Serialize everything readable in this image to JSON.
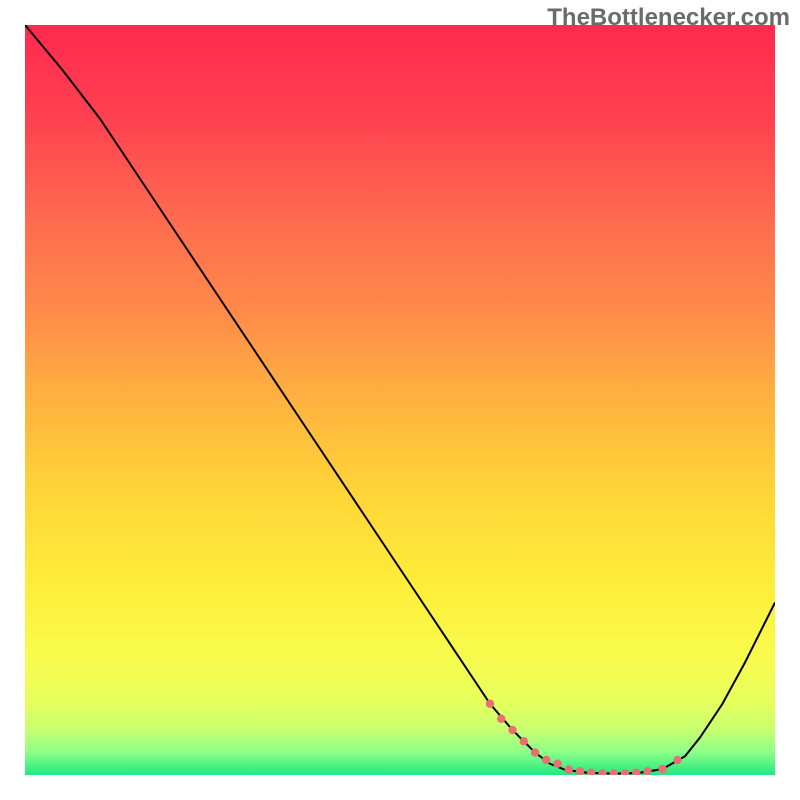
{
  "watermark": "TheBottlenecker.com",
  "chart_data": {
    "type": "line",
    "title": "",
    "xlabel": "",
    "ylabel": "",
    "xlim": [
      0,
      100
    ],
    "ylim": [
      0,
      100
    ],
    "series": [
      {
        "name": "curve",
        "x": [
          0,
          5,
          10,
          15,
          20,
          25,
          30,
          35,
          40,
          45,
          50,
          55,
          60,
          62,
          65,
          68,
          70,
          72,
          75,
          78,
          80,
          82,
          85,
          88,
          90,
          93,
          96,
          100
        ],
        "y": [
          100,
          94,
          87.5,
          80,
          72.5,
          65,
          57.5,
          50,
          42.5,
          35,
          27.5,
          20,
          12.5,
          9.5,
          6,
          3,
          1.5,
          0.7,
          0.3,
          0.2,
          0.2,
          0.3,
          0.8,
          2.5,
          5,
          9.5,
          15,
          23
        ]
      },
      {
        "name": "highlight",
        "x": [
          62,
          63.5,
          65,
          66.5,
          68,
          69.5,
          71,
          72.5,
          74,
          75.5,
          77,
          78.5,
          80,
          81.5,
          83,
          85,
          87
        ],
        "y": [
          9.5,
          7.5,
          6,
          4.5,
          3,
          2,
          1.5,
          0.7,
          0.5,
          0.3,
          0.2,
          0.2,
          0.2,
          0.3,
          0.5,
          0.8,
          2.0
        ]
      }
    ],
    "gradient_stops": [
      {
        "offset": 0.0,
        "color": "#ff2a4e"
      },
      {
        "offset": 0.12,
        "color": "#ff4050"
      },
      {
        "offset": 0.25,
        "color": "#ff6850"
      },
      {
        "offset": 0.38,
        "color": "#ff8a4a"
      },
      {
        "offset": 0.5,
        "color": "#ffb23f"
      },
      {
        "offset": 0.62,
        "color": "#ffd438"
      },
      {
        "offset": 0.75,
        "color": "#ffee3a"
      },
      {
        "offset": 0.84,
        "color": "#f8fb4c"
      },
      {
        "offset": 0.9,
        "color": "#e8ff5c"
      },
      {
        "offset": 0.94,
        "color": "#c8ff70"
      },
      {
        "offset": 0.97,
        "color": "#8cff88"
      },
      {
        "offset": 1.0,
        "color": "#20e880"
      }
    ],
    "highlight_color": "#e87070"
  }
}
